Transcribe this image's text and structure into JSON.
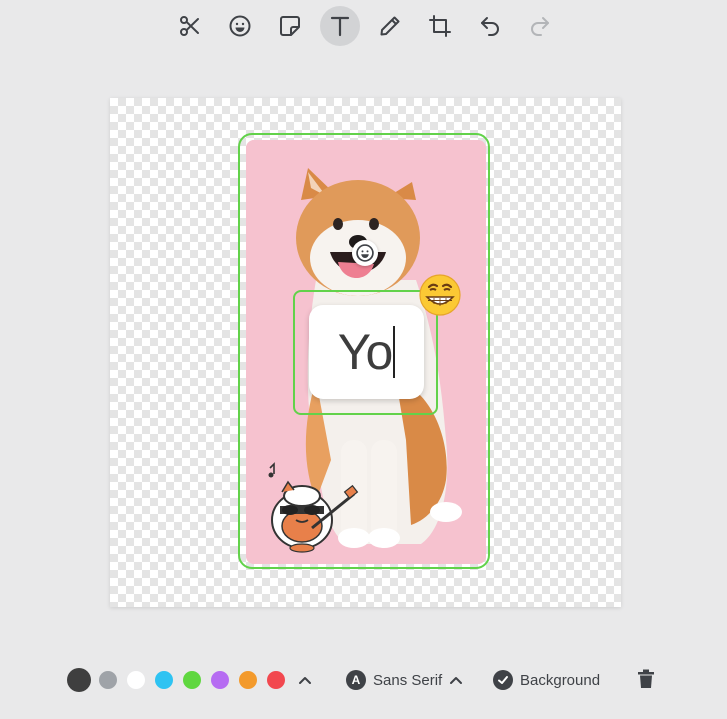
{
  "toolbar": {
    "tools": [
      {
        "icon": "scissors-icon",
        "active": false
      },
      {
        "icon": "emoji-icon",
        "active": false
      },
      {
        "icon": "sticker-icon",
        "active": false
      },
      {
        "icon": "text-icon",
        "active": true
      },
      {
        "icon": "pencil-icon",
        "active": false
      },
      {
        "icon": "crop-icon",
        "active": false
      },
      {
        "icon": "undo-icon",
        "active": false
      },
      {
        "icon": "redo-icon",
        "active": false,
        "disabled": true
      }
    ]
  },
  "canvas": {
    "text_value": "Yo",
    "frame_color": "#62d24a",
    "photo_background": "#f6c2cf"
  },
  "stickers": [
    "smiling-face-icon",
    "grinning-face-emoji",
    "hamster-guitar-sticker"
  ],
  "bottom_bar": {
    "colors": [
      {
        "name": "dark-gray",
        "hex": "#3f3f3f",
        "selected": true
      },
      {
        "name": "gray",
        "hex": "#9fa3a8"
      },
      {
        "name": "white",
        "hex": "#ffffff"
      },
      {
        "name": "sky-blue",
        "hex": "#2ec3f2"
      },
      {
        "name": "green",
        "hex": "#5fd73f"
      },
      {
        "name": "purple",
        "hex": "#b66cf2"
      },
      {
        "name": "orange",
        "hex": "#f39a2c"
      },
      {
        "name": "red",
        "hex": "#f2484f"
      }
    ],
    "font_letter": "A",
    "font_label": "Sans Serif",
    "background_label": "Background"
  }
}
